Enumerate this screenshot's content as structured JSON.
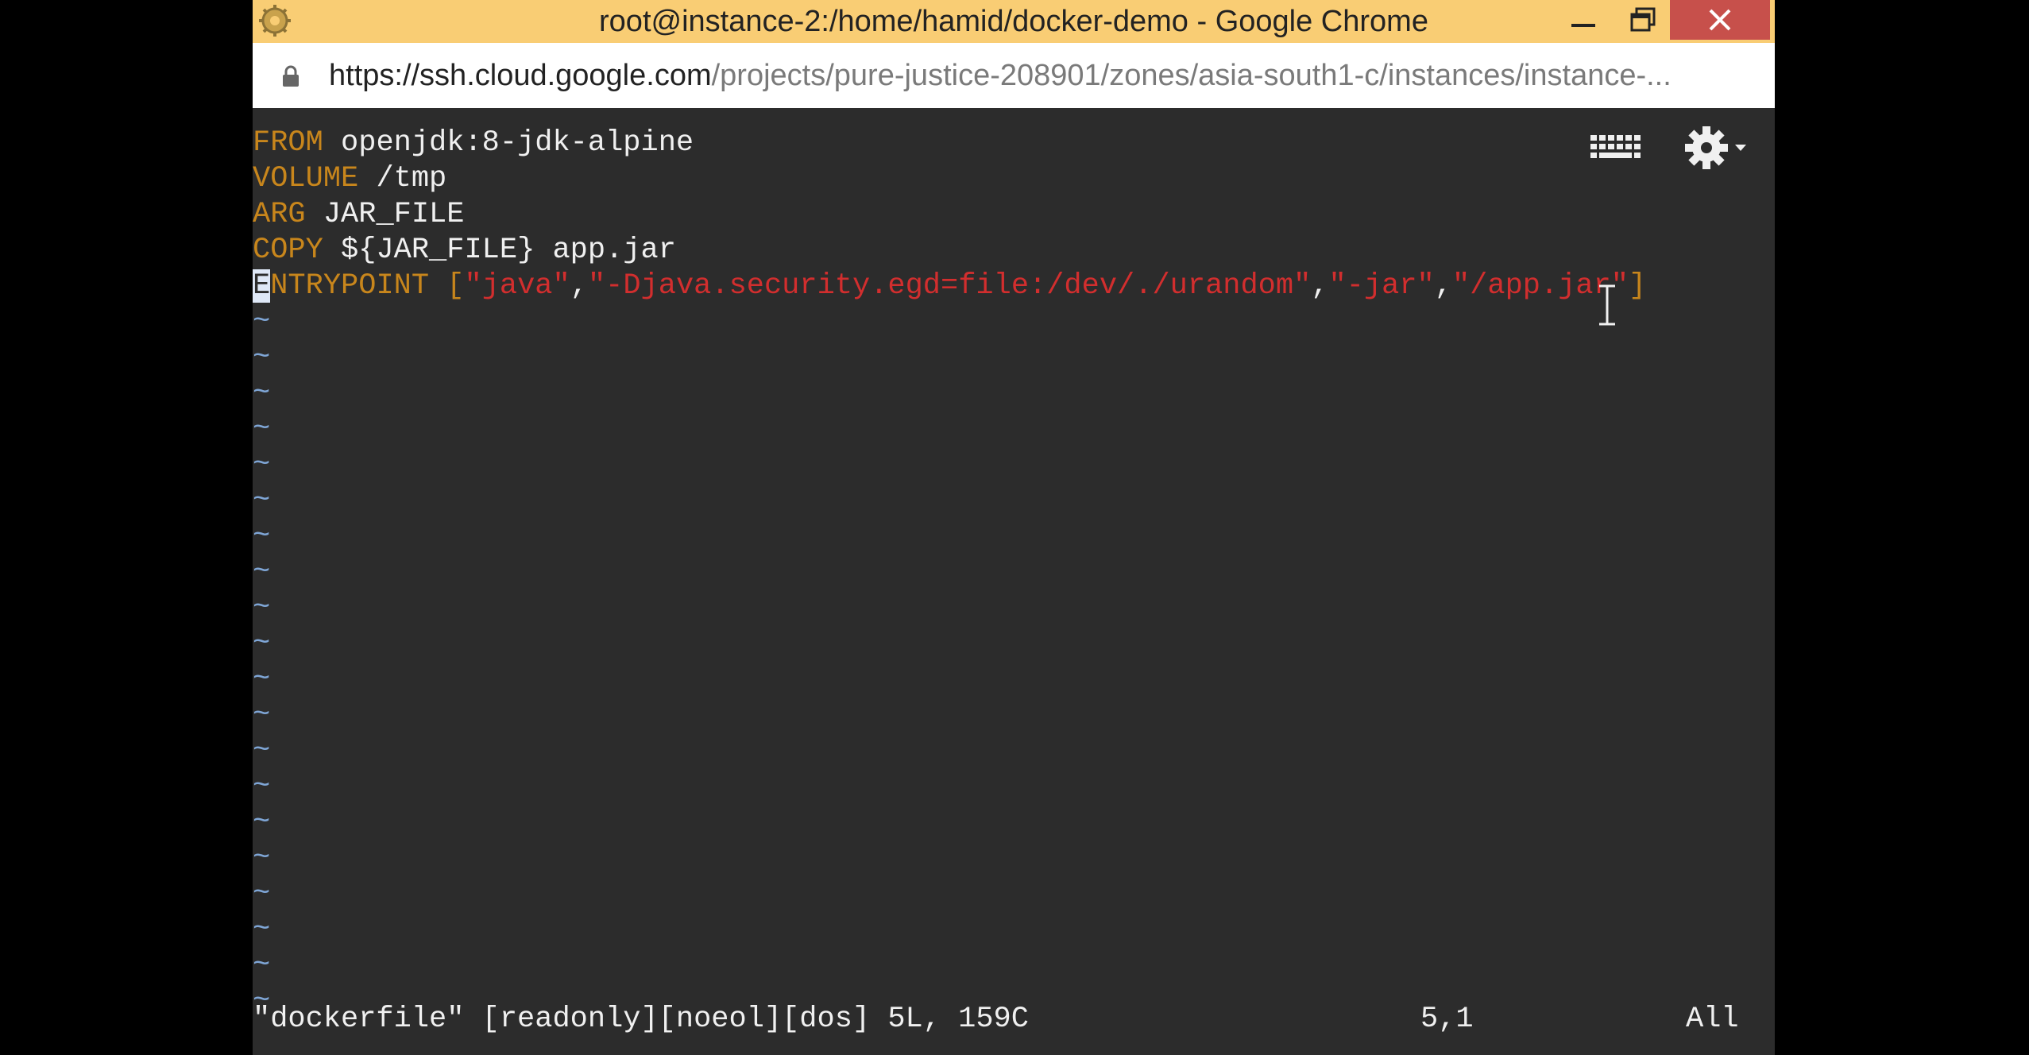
{
  "window": {
    "title": "root@instance-2:/home/hamid/docker-demo - Google Chrome",
    "url_host": "https://ssh.cloud.google.com",
    "url_path": "/projects/pure-justice-208901/zones/asia-south1-c/instances/instance-..."
  },
  "editor": {
    "lines": [
      {
        "kw": "FROM",
        "rest": " openjdk:8-jdk-alpine"
      },
      {
        "kw": "VOLUME",
        "rest": " /tmp"
      },
      {
        "kw": "ARG",
        "rest": " JAR_FILE"
      },
      {
        "kw": "COPY",
        "rest": " ${JAR_FILE} app.jar"
      }
    ],
    "entrypoint": {
      "cursor_char": "E",
      "kw_rest": "NTRYPOINT",
      "open": " [",
      "args": [
        "\"java\"",
        "\"-Djava.security.egd=file:/dev/./urandom\"",
        "\"-jar\"",
        "\"/app.jar\""
      ],
      "sep": ",",
      "close": "]"
    },
    "tilde": "~",
    "tilde_count": 20,
    "status_message": "\"dockerfile\" [readonly][noeol][dos] 5L, 159C",
    "cursor_position": "5,1",
    "scroll_indicator": "All"
  },
  "icons": {
    "app": "chrome-ssh-app-icon",
    "lock": "lock-icon",
    "keyboard": "keyboard-icon",
    "settings": "gear-icon",
    "minimize": "minimize-icon",
    "maximize": "restore-icon",
    "close": "close-icon"
  }
}
